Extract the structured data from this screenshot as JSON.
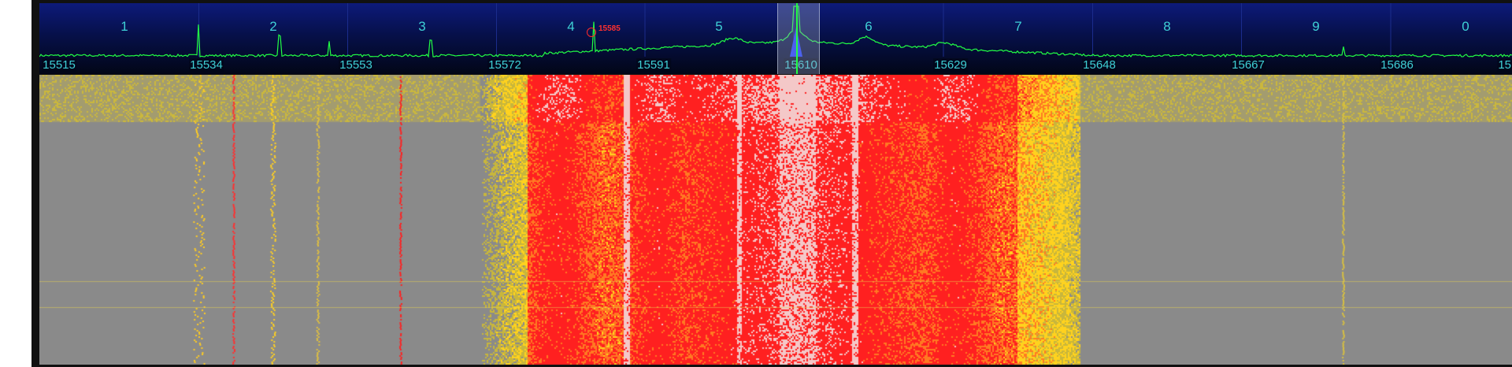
{
  "app": {
    "channels": [
      "1",
      "2",
      "3",
      "4",
      "5",
      "6",
      "7",
      "8",
      "9",
      "0"
    ],
    "frequency_scale": [
      "15515",
      "15534",
      "15553",
      "15572",
      "15591",
      "15610",
      "15629",
      "15648",
      "15667",
      "15686",
      "15"
    ],
    "peak_marker_label": "15585",
    "tuned_frequency": "15610"
  },
  "colors": {
    "spectrum_trace": "#22ff44",
    "label_cyan": "#3fd0d6",
    "peak_red": "#ff2a2a",
    "waterfall_bg": "#8a8a8a",
    "waterfall_low": "#c8b63c",
    "waterfall_mid": "#ffd21e",
    "waterfall_high": "#ff2020"
  }
}
